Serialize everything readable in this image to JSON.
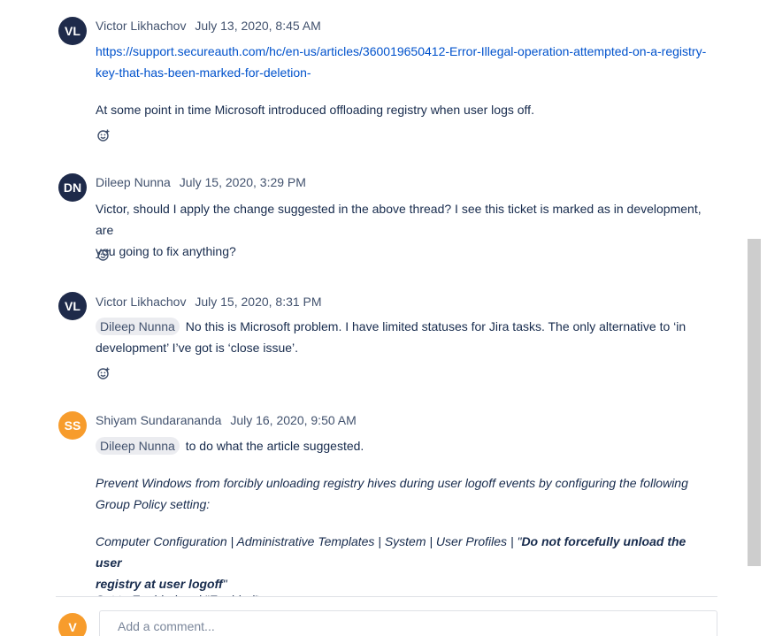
{
  "comments": [
    {
      "initials": "VL",
      "author": "Victor Likhachov",
      "date": "July 13, 2020, 8:45 AM",
      "link_line1": "https://support.secureauth.com/hc/en-us/articles/360019650412-Error-Illegal-operation-attempted-on-a-registry-",
      "link_line2": "key-that-has-been-marked-for-deletion-",
      "text": "At some point in time Microsoft introduced offloading registry when user logs off."
    },
    {
      "initials": "DN",
      "author": "Dileep Nunna",
      "date": "July 15, 2020, 3:29 PM",
      "text_line1": "Victor, should I apply the change suggested in the above thread? I see this ticket is marked as in development, are",
      "text_line2": "you going to fix anything?"
    },
    {
      "initials": "VL",
      "author": "Victor Likhachov",
      "date": "July 15, 2020, 8:31 PM",
      "mention": "Dileep Nunna",
      "text_line1": "No this is Microsoft  problem. I have limited statuses for Jira tasks.  The only alternative to ‘in",
      "text_line2": "development’ I’ve got is ‘close issue’."
    },
    {
      "initials": "SS",
      "author": "Shiyam Sundarananda",
      "date": "July 16, 2020, 9:50 AM",
      "mention": "Dileep Nunna",
      "text": "to do what the article suggested.",
      "quote_line1": "Prevent Windows from forcibly unloading registry hives during user logoff events by configuring the following",
      "quote_line2": "Group Policy setting:",
      "path_prefix": "Computer Configuration | Administrative Templates | System | User Profiles | \"",
      "path_bold": "Do not forcefully unload the user",
      "path_bold_line2": "registry at user logoff",
      "path_suffix": "\"",
      "cut_line": "Set to Enabled and \"Enabled\""
    }
  ],
  "composer": {
    "initials": "V",
    "placeholder": "Add a comment..."
  },
  "icons": {
    "reaction": "add-reaction-icon"
  }
}
